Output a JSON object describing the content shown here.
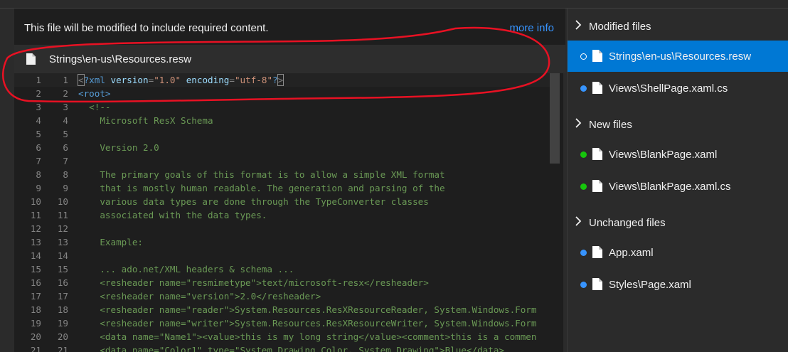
{
  "colors": {
    "modified_dot": "#3794ff",
    "new_dot": "#16c60c",
    "unchanged_dot": "#3794ff",
    "selected_bg": "#0078d4",
    "annotation": "#e81123"
  },
  "main": {
    "info_text": "This file will be modified to include required content.",
    "more_info": "more info",
    "file_header": {
      "icon": "document-icon",
      "path": "Strings\\en-us\\Resources.resw"
    }
  },
  "editor": {
    "lines": [
      {
        "n1": "1",
        "n2": "1",
        "parts": [
          [
            "b",
            "<"
          ],
          [
            "t",
            "?xml "
          ],
          [
            "a",
            "version"
          ],
          [
            "p",
            "="
          ],
          [
            "s",
            "\"1.0\""
          ],
          [
            "p",
            " "
          ],
          [
            "a",
            "encoding"
          ],
          [
            "p",
            "="
          ],
          [
            "s",
            "\"utf-8\""
          ],
          [
            "t",
            "?"
          ],
          [
            "b",
            ">"
          ]
        ]
      },
      {
        "n1": "2",
        "n2": "2",
        "parts": [
          [
            "t",
            "<root>"
          ]
        ]
      },
      {
        "n1": "3",
        "n2": "3",
        "parts": [
          [
            "c",
            "  <!--"
          ]
        ]
      },
      {
        "n1": "4",
        "n2": "4",
        "parts": [
          [
            "c",
            "    Microsoft ResX Schema"
          ]
        ]
      },
      {
        "n1": "5",
        "n2": "5",
        "parts": [
          [
            "c",
            ""
          ]
        ]
      },
      {
        "n1": "6",
        "n2": "6",
        "parts": [
          [
            "c",
            "    Version 2.0"
          ]
        ]
      },
      {
        "n1": "7",
        "n2": "7",
        "parts": [
          [
            "c",
            ""
          ]
        ]
      },
      {
        "n1": "8",
        "n2": "8",
        "parts": [
          [
            "c",
            "    The primary goals of this format is to allow a simple XML format"
          ]
        ]
      },
      {
        "n1": "9",
        "n2": "9",
        "parts": [
          [
            "c",
            "    that is mostly human readable. The generation and parsing of the"
          ]
        ]
      },
      {
        "n1": "10",
        "n2": "10",
        "parts": [
          [
            "c",
            "    various data types are done through the TypeConverter classes"
          ]
        ]
      },
      {
        "n1": "11",
        "n2": "11",
        "parts": [
          [
            "c",
            "    associated with the data types."
          ]
        ]
      },
      {
        "n1": "12",
        "n2": "12",
        "parts": [
          [
            "c",
            ""
          ]
        ]
      },
      {
        "n1": "13",
        "n2": "13",
        "parts": [
          [
            "c",
            "    Example:"
          ]
        ]
      },
      {
        "n1": "14",
        "n2": "14",
        "parts": [
          [
            "c",
            ""
          ]
        ]
      },
      {
        "n1": "15",
        "n2": "15",
        "parts": [
          [
            "c",
            "    ... ado.net/XML headers & schema ..."
          ]
        ]
      },
      {
        "n1": "16",
        "n2": "16",
        "parts": [
          [
            "c",
            "    <resheader name=\"resmimetype\">text/microsoft-resx</resheader>"
          ]
        ]
      },
      {
        "n1": "17",
        "n2": "17",
        "parts": [
          [
            "c",
            "    <resheader name=\"version\">2.0</resheader>"
          ]
        ]
      },
      {
        "n1": "18",
        "n2": "18",
        "parts": [
          [
            "c",
            "    <resheader name=\"reader\">System.Resources.ResXResourceReader, System.Windows.Form"
          ]
        ]
      },
      {
        "n1": "19",
        "n2": "19",
        "parts": [
          [
            "c",
            "    <resheader name=\"writer\">System.Resources.ResXResourceWriter, System.Windows.Form"
          ]
        ]
      },
      {
        "n1": "20",
        "n2": "20",
        "parts": [
          [
            "c",
            "    <data name=\"Name1\"><value>this is my long string</value><comment>this is a commen"
          ]
        ]
      },
      {
        "n1": "21",
        "n2": "21",
        "parts": [
          [
            "c",
            "    <data name=\"Color1\" type=\"System.Drawing.Color, System.Drawing\">Blue</data>"
          ]
        ]
      }
    ]
  },
  "sidebar": {
    "sections": [
      {
        "label": "Modified files",
        "icon": "chevron-right-icon",
        "items": [
          {
            "name": "Strings\\en-us\\Resources.resw",
            "status": "modified",
            "selected": true
          },
          {
            "name": "Views\\ShellPage.xaml.cs",
            "status": "modified",
            "selected": false
          }
        ]
      },
      {
        "label": "New files",
        "icon": "chevron-right-icon",
        "items": [
          {
            "name": "Views\\BlankPage.xaml",
            "status": "new",
            "selected": false
          },
          {
            "name": "Views\\BlankPage.xaml.cs",
            "status": "new",
            "selected": false
          }
        ]
      },
      {
        "label": "Unchanged files",
        "icon": "chevron-right-icon",
        "items": [
          {
            "name": "App.xaml",
            "status": "unchanged",
            "selected": false
          },
          {
            "name": "Styles\\Page.xaml",
            "status": "unchanged",
            "selected": false
          }
        ]
      }
    ]
  }
}
